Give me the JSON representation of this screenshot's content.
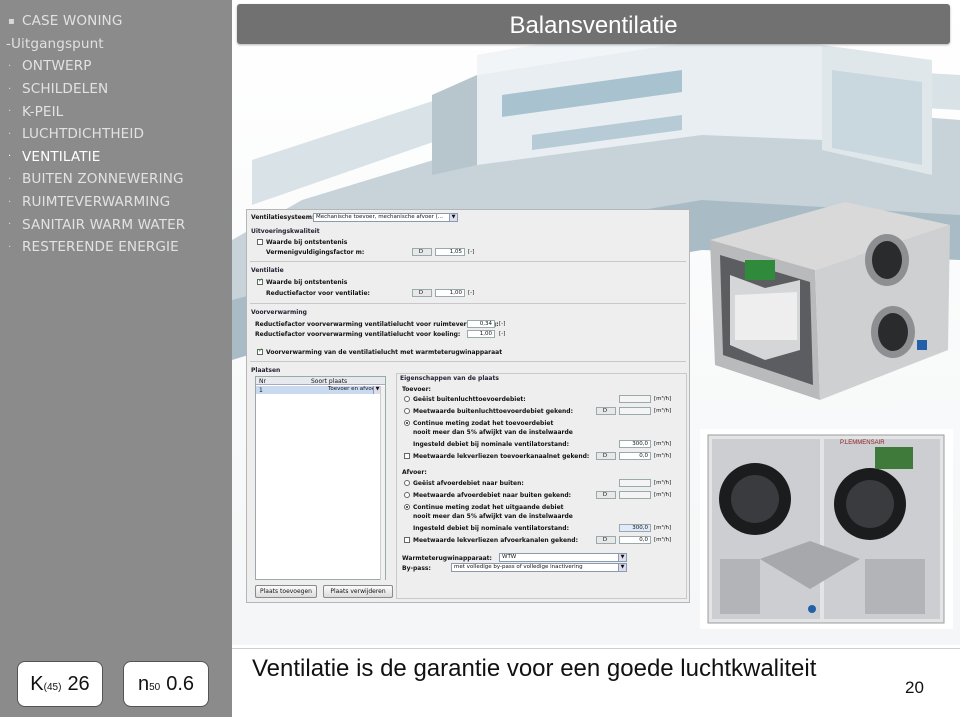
{
  "sidebar": {
    "items": [
      {
        "bullet": "▪",
        "label": "CASE WONING",
        "style": "section"
      },
      {
        "bullet": "",
        "label": "-Uitgangspunt",
        "style": "sub"
      },
      {
        "bullet": "·",
        "label": "ONTWERP",
        "style": "normal"
      },
      {
        "bullet": "·",
        "label": "SCHILDELEN",
        "style": "normal"
      },
      {
        "bullet": "·",
        "label": "K-PEIL",
        "style": "normal"
      },
      {
        "bullet": "·",
        "label": "LUCHTDICHTHEID",
        "style": "normal"
      },
      {
        "bullet": "·",
        "label": "VENTILATIE",
        "style": "active"
      },
      {
        "bullet": "·",
        "label": "BUITEN ZONNEWERING",
        "style": "normal"
      },
      {
        "bullet": "·",
        "label": "RUIMTEVERWARMING",
        "style": "normal"
      },
      {
        "bullet": "·",
        "label": "SANITAIR WARM WATER",
        "style": "normal"
      },
      {
        "bullet": "·",
        "label": "RESTERENDE ENERGIE",
        "style": "normal"
      }
    ],
    "k_label": "K",
    "k_sub": "(45)",
    "k_value": "26",
    "n_label": "n",
    "n_sub": "50",
    "n_value": "0.6"
  },
  "header": {
    "title": "Balansventilatie"
  },
  "dialog": {
    "system_label": "Ventilatiesysteem:",
    "system_value": "Mechanische toevoer, mechanische afvoer (...",
    "uitvoering": {
      "title": "Uitvoeringskwaliteit",
      "checkbox": "Waarde bij ontstentenis",
      "factor_label": "Vermenigvuldigingsfactor m:",
      "factor_d": "D",
      "factor_value": "1,05",
      "factor_unit": "[-]"
    },
    "ventilatie": {
      "title": "Ventilatie",
      "checkbox": "Waarde bij ontstentenis",
      "factor_label": "Reductiefactor voor ventilatie:",
      "factor_d": "D",
      "factor_value": "1,00",
      "factor_unit": "[-]"
    },
    "voorverwarming": {
      "title": "Voorverwarming",
      "row1_label": "Reductiefactor voorverwarming ventilatielucht voor ruimteverwarming:",
      "row1_value": "0,34",
      "row1_unit": "[-]",
      "row2_label": "Reductiefactor voorverwarming ventilatielucht voor koeling:",
      "row2_value": "1,00",
      "row2_unit": "[-]",
      "checkbox": "Voorverwarming van de ventilatielucht met warmteterugwinapparaat"
    },
    "plaatsen": {
      "title": "Plaatsen",
      "col_nr": "Nr",
      "col_soort": "Soort plaats",
      "row_nr": "1",
      "row_soort": "Toevoer en afvoer",
      "btn_add": "Plaats toevoegen",
      "btn_remove": "Plaats verwijderen"
    },
    "eigenschappen": {
      "title": "Eigenschappen van de plaats",
      "toevoer_title": "Toevoer:",
      "t_r1": "Geëist buitenluchttoevoerdebiet:",
      "t_r1_unit": "[m³/h]",
      "t_r2": "Meetwaarde buitenluchttoevoerdebiet gekend:",
      "t_r2_d": "D",
      "t_r2_unit": "[m³/h]",
      "t_r3a": "Continue meting zodat het toevoerdebiet",
      "t_r3b": "nooit meer dan 5% afwijkt van de instelwaarde",
      "t_r4": "Ingesteld debiet bij nominale ventilatorstand:",
      "t_r4_value": "300,0",
      "t_r4_unit": "[m³/h]",
      "t_r5": "Meetwaarde lekverliezen toevoerkanaalnet gekend:",
      "t_r5_d": "D",
      "t_r5_value": "0,0",
      "t_r5_unit": "[m³/h]",
      "afvoer_title": "Afvoer:",
      "a_r1": "Geëist afvoerdebiet naar buiten:",
      "a_r1_unit": "[m³/h]",
      "a_r2": "Meetwaarde afvoerdebiet naar buiten gekend:",
      "a_r2_d": "D",
      "a_r2_unit": "[m³/h]",
      "a_r3a": "Continue meting zodat het uitgaande debiet",
      "a_r3b": "nooit meer dan 5% afwijkt van de instelwaarde",
      "a_r4": "Ingesteld debiet bij nominale ventilatorstand:",
      "a_r4_value": "300,0",
      "a_r4_unit": "[m³/h]",
      "a_r5": "Meetwaarde lekverliezen afvoerkanalen gekend:",
      "a_r5_d": "D",
      "a_r5_value": "0,0",
      "a_r5_unit": "[m³/h]",
      "wtw_label": "Warmteterugwinapparaat:",
      "wtw_value": "WTW",
      "bypass_label": "By-pass:",
      "bypass_value": "met volledige by-pass of volledige inactivering"
    }
  },
  "photo_brand": "P.LEMMENSAIR",
  "footer": {
    "subtitle": "Ventilatie is de garantie voor een goede luchtkwaliteit",
    "page_number": "20"
  }
}
